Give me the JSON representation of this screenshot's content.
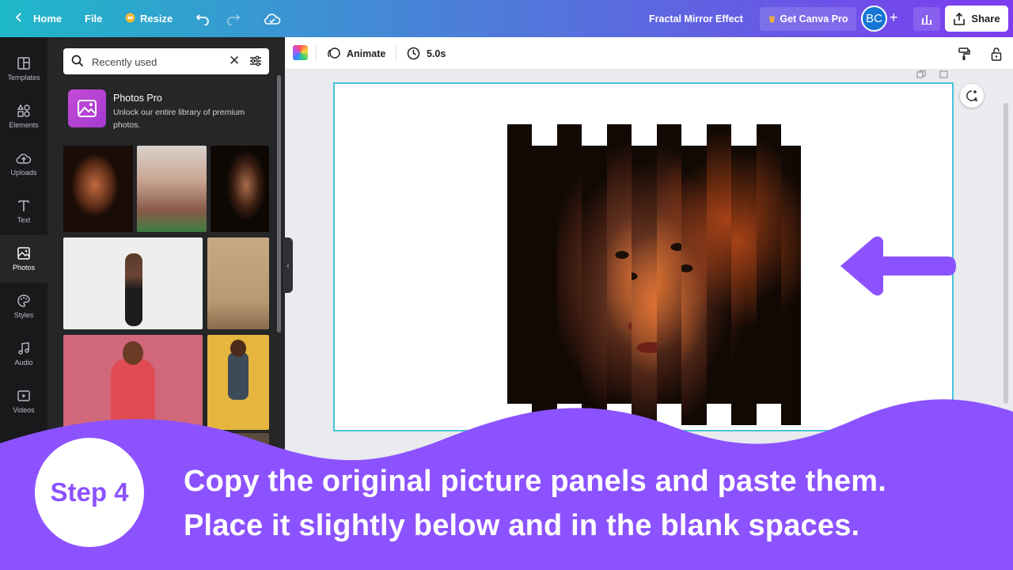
{
  "topbar": {
    "home_label": "Home",
    "file_label": "File",
    "resize_label": "Resize",
    "design_title": "Fractal Mirror Effect",
    "get_pro_label": "Get Canva Pro",
    "avatar_initials": "BC",
    "share_label": "Share",
    "gradient_colors": [
      "#1fb8c9",
      "#4b7fd8",
      "#7d3cf0"
    ]
  },
  "rail": {
    "items": [
      {
        "label": "Templates",
        "icon": "templates-icon"
      },
      {
        "label": "Elements",
        "icon": "elements-icon"
      },
      {
        "label": "Uploads",
        "icon": "uploads-icon"
      },
      {
        "label": "Text",
        "icon": "text-icon"
      },
      {
        "label": "Photos",
        "icon": "photos-icon",
        "active": true
      },
      {
        "label": "Styles",
        "icon": "styles-icon"
      },
      {
        "label": "Audio",
        "icon": "audio-icon"
      },
      {
        "label": "Videos",
        "icon": "videos-icon"
      }
    ]
  },
  "panel": {
    "search_value": "Recently used",
    "promo_title": "Photos Pro",
    "promo_description": "Unlock our entire library of premium photos."
  },
  "editor_toolbar": {
    "animate_label": "Animate",
    "duration_label": "5.0s"
  },
  "banner": {
    "step_label": "Step 4",
    "instruction_line1": "Copy the original picture panels and paste them.",
    "instruction_line2": "Place it slightly below and in the blank spaces.",
    "accent_color": "#8c52ff"
  }
}
